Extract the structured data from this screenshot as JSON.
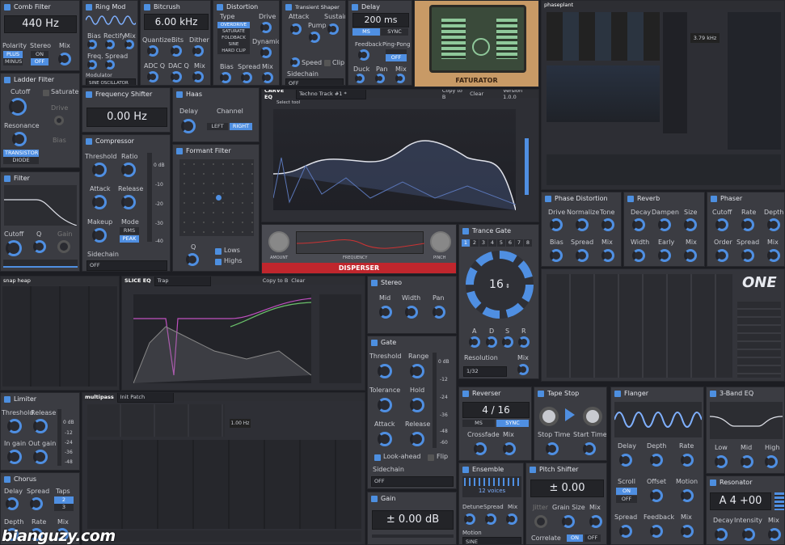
{
  "comb": {
    "title": "Comb Filter",
    "freq": "440 Hz",
    "polarity": "Polarity",
    "stereo": "Stereo",
    "mix": "Mix",
    "plus": "PLUS",
    "minus": "MINUS",
    "on": "ON",
    "off": "OFF"
  },
  "ringmod": {
    "title": "Ring Mod",
    "bias": "Bias",
    "rectify": "Rectify",
    "mix": "Mix",
    "freq": "Freq.",
    "spread": "Spread",
    "modulator": "Modulator",
    "mod_value": "SINE OSCILLATOR"
  },
  "bitcrush": {
    "title": "Bitcrush",
    "rate": "6.00 kHz",
    "quantize": "Quantize",
    "bits": "Bits",
    "dither": "Dither",
    "adcq": "ADC Q",
    "dacq": "DAC Q",
    "mix": "Mix"
  },
  "distortion": {
    "title": "Distortion",
    "type": "Type",
    "drive": "Drive",
    "types": [
      "OVERDRIVE",
      "SATURATE",
      "FOLDBACK",
      "SINE",
      "HARD CLIP"
    ],
    "dynamics": "Dynamics",
    "bias": "Bias",
    "spread": "Spread",
    "mix": "Mix"
  },
  "transient": {
    "title": "Transient Shaper",
    "attack": "Attack",
    "pump": "Pump",
    "sustain": "Sustain",
    "speed": "Speed",
    "clip": "Clip",
    "sidechain": "Sidechain",
    "sc_value": "OFF"
  },
  "delay": {
    "title": "Delay",
    "time": "200 ms",
    "ms": "MS",
    "sync": "SYNC",
    "feedback": "Feedback",
    "pingpong": "Ping-Pong",
    "off": "OFF",
    "duck": "Duck",
    "pan": "Pan",
    "mix": "Mix"
  },
  "faturator": {
    "name": "FATURATOR"
  },
  "phaseplant": {
    "name": "phaseplant",
    "freq": "3.79 kHz"
  },
  "ladder": {
    "title": "Ladder Filter",
    "cutoff": "Cutoff",
    "saturate": "Saturate",
    "drive": "Drive",
    "resonance": "Resonance",
    "bias": "Bias",
    "transistor": "TRANSISTOR",
    "diode": "DIODE"
  },
  "freqshift": {
    "title": "Frequency Shifter",
    "value": "0.00 Hz"
  },
  "haas": {
    "title": "Haas",
    "delay": "Delay",
    "channel": "Channel",
    "left": "LEFT",
    "right": "RIGHT"
  },
  "compressor": {
    "title": "Compressor",
    "threshold": "Threshold",
    "ratio": "Ratio",
    "attack": "Attack",
    "release": "Release",
    "makeup": "Makeup",
    "mode": "Mode",
    "rms": "RMS",
    "peak": "PEAK",
    "sidechain": "Sidechain",
    "sc_value": "OFF",
    "scale": [
      "0 dB",
      "-10",
      "-20",
      "-30",
      "-40"
    ]
  },
  "formant": {
    "title": "Formant Filter",
    "q": "Q",
    "lows": "Lows",
    "highs": "Highs"
  },
  "carve": {
    "name": "CARVE EQ",
    "preset": "Techno Track #1 *",
    "version": "Version 1.0.0",
    "copy": "Copy to B",
    "clear": "Clear",
    "select": "Select tool"
  },
  "filter": {
    "title": "Filter",
    "cutoff": "Cutoff",
    "q": "Q",
    "gain": "Gain"
  },
  "disperser": {
    "name": "DISPERSER",
    "amount": "AMOUNT",
    "frequency": "FREQUENCY",
    "pinch": "PINCH"
  },
  "trancegate": {
    "title": "Trance Gate",
    "steps": [
      "1",
      "2",
      "3",
      "4",
      "5",
      "6",
      "7",
      "8"
    ],
    "value": "16",
    "a": "A",
    "d": "D",
    "s": "S",
    "r": "R",
    "resolution": "Resolution",
    "res_value": "1/32",
    "mix": "Mix"
  },
  "phasedist": {
    "title": "Phase Distortion",
    "drive": "Drive",
    "normalize": "Normalize",
    "tone": "Tone",
    "bias": "Bias",
    "spread": "Spread",
    "mix": "Mix"
  },
  "reverb": {
    "title": "Reverb",
    "decay": "Decay",
    "dampen": "Dampen",
    "size": "Size",
    "width": "Width",
    "early": "Early",
    "mix": "Mix"
  },
  "phaser": {
    "title": "Phaser",
    "cutoff": "Cutoff",
    "rate": "Rate",
    "depth": "Depth",
    "order": "Order",
    "spread": "Spread",
    "mix": "Mix"
  },
  "snapheap": {
    "name": "snap heap"
  },
  "slice": {
    "name": "SLICE EQ",
    "preset": "Trap",
    "copy": "Copy to B",
    "clear": "Clear"
  },
  "stereo": {
    "title": "Stereo",
    "mid": "Mid",
    "width": "Width",
    "pan": "Pan"
  },
  "gate": {
    "title": "Gate",
    "threshold": "Threshold",
    "range": "Range",
    "tolerance": "Tolerance",
    "hold": "Hold",
    "attack": "Attack",
    "release": "Release",
    "lookahead": "Look-ahead",
    "flip": "Flip",
    "sidechain": "Sidechain",
    "sc_value": "OFF",
    "scale": [
      "0 dB",
      "-12",
      "-24",
      "-36",
      "-48",
      "-60"
    ]
  },
  "one": {
    "name": "ONE"
  },
  "limiter": {
    "title": "Limiter",
    "threshold": "Threshold",
    "release": "Release",
    "ingain": "In gain",
    "outgain": "Out gain",
    "scale": [
      "0 dB",
      "-12",
      "-24",
      "-36",
      "-48"
    ]
  },
  "multipass": {
    "name": "multipass",
    "preset": "Init Patch",
    "freq": "1.00 Hz"
  },
  "chorus": {
    "title": "Chorus",
    "delay": "Delay",
    "spread": "Spread",
    "taps": "Taps",
    "taps_a": "2",
    "taps_b": "3",
    "depth": "Depth",
    "rate": "Rate",
    "mix": "Mix"
  },
  "reverser": {
    "title": "Reverser",
    "value": "4 / 16",
    "ms": "MS",
    "sync": "SYNC",
    "crossfade": "Crossfade",
    "mix": "Mix"
  },
  "tapestop": {
    "title": "Tape Stop",
    "stop": "Stop Time",
    "start": "Start Time"
  },
  "flanger": {
    "title": "Flanger",
    "delay": "Delay",
    "depth": "Depth",
    "rate": "Rate",
    "scroll": "Scroll",
    "on": "ON",
    "off": "OFF",
    "offset": "Offset",
    "motion": "Motion",
    "spread": "Spread",
    "feedback": "Feedback",
    "mix": "Mix"
  },
  "eq3": {
    "title": "3-Band EQ",
    "low": "Low",
    "mid": "Mid",
    "high": "High"
  },
  "ensemble": {
    "title": "Ensemble",
    "voices": "12 voices",
    "detune": "Detune",
    "spread": "Spread",
    "mix": "Mix",
    "motion": "Motion",
    "motion_value": "SINE"
  },
  "pitch": {
    "title": "Pitch Shifter",
    "value": "± 0.00",
    "jitter": "Jitter",
    "grain": "Grain Size",
    "mix": "Mix",
    "correlate": "Correlate",
    "on": "ON",
    "off": "OFF"
  },
  "gain": {
    "title": "Gain",
    "value": "± 0.00 dB"
  },
  "resonator": {
    "title": "Resonator",
    "note": "A 4 +00",
    "decay": "Decay",
    "intensity": "Intensity",
    "mix": "Mix"
  },
  "watermark": {
    "text": "bianguzy.com"
  }
}
